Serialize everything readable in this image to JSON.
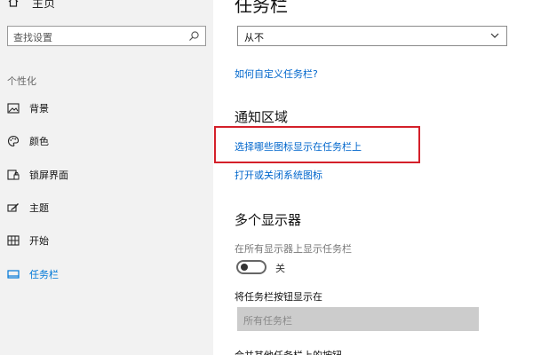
{
  "sidebar": {
    "home_label": "主页",
    "search_placeholder": "查找设置",
    "section_title": "个性化",
    "items": [
      {
        "label": "背景"
      },
      {
        "label": "颜色"
      },
      {
        "label": "锁屏界面"
      },
      {
        "label": "主题"
      },
      {
        "label": "开始"
      },
      {
        "label": "任务栏"
      }
    ]
  },
  "main": {
    "page_title": "任务栏",
    "combine_select_value": "从不",
    "customize_link": "如何自定义任务栏?",
    "notification_area": {
      "title": "通知区域",
      "link_select_icons": "选择哪些图标显示在任务栏上",
      "link_system_icons": "打开或关闭系统图标"
    },
    "multi_display": {
      "title": "多个显示器",
      "show_on_all_label": "在所有显示器上显示任务栏",
      "toggle_state": "关",
      "show_buttons_label": "将任务栏按钮显示在",
      "show_buttons_value": "所有任务栏",
      "cut_off_text": "合并其他任务栏上的按钮"
    }
  },
  "colors": {
    "accent": "#0078d7",
    "link": "#0066cc",
    "highlight_border": "#d4202a",
    "sidebar_bg": "#f2f2f2"
  },
  "icons": {
    "home": "home-icon",
    "search": "search-icon",
    "background": "picture-icon",
    "colors": "palette-icon",
    "lockscreen": "lockscreen-icon",
    "themes": "brush-icon",
    "start": "start-grid-icon",
    "taskbar": "taskbar-icon",
    "dropdown": "chevron-down-icon"
  }
}
